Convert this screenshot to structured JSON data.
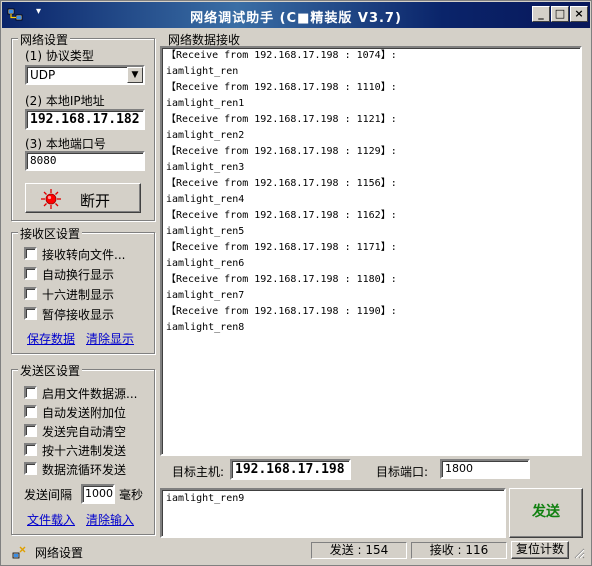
{
  "window": {
    "title": "网络调试助手 (C■精装版 V3.7)",
    "sysmenu_label": "▾",
    "minimize_label": "_",
    "maximize_label": "□",
    "close_label": "×"
  },
  "net_settings": {
    "group_title": "网络设置",
    "protocol_label": "(1) 协议类型",
    "protocol_value": "UDP",
    "ip_label": "(2) 本地IP地址",
    "ip_value": "192.168.17.182",
    "port_label": "(3) 本地端口号",
    "port_value": "8080",
    "connect_button": "断开"
  },
  "recv_settings": {
    "group_title": "接收区设置",
    "options": [
      {
        "label": "接收转向文件...",
        "checked": false
      },
      {
        "label": "自动换行显示",
        "checked": false
      },
      {
        "label": "十六进制显示",
        "checked": false
      },
      {
        "label": "暂停接收显示",
        "checked": false
      }
    ],
    "save_link": "保存数据",
    "clear_link": "清除显示"
  },
  "send_settings": {
    "group_title": "发送区设置",
    "options": [
      {
        "label": "启用文件数据源...",
        "checked": false
      },
      {
        "label": "自动发送附加位",
        "checked": false
      },
      {
        "label": "发送完自动清空",
        "checked": false
      },
      {
        "label": "按十六进制发送",
        "checked": false
      },
      {
        "label": "数据流循环发送",
        "checked": false
      }
    ],
    "interval_label": "发送间隔",
    "interval_value": "1000",
    "interval_unit": "毫秒",
    "load_link": "文件载入",
    "clear_link": "清除输入"
  },
  "receive_area": {
    "group_title": "网络数据接收",
    "lines": [
      {
        "kind": "hdr",
        "text": "【Receive from 192.168.17.198 : 1074】:"
      },
      {
        "kind": "data",
        "text": "iamlight_ren"
      },
      {
        "kind": "hdr",
        "text": "【Receive from 192.168.17.198 : 1110】:"
      },
      {
        "kind": "data",
        "text": "iamlight_ren1"
      },
      {
        "kind": "hdr",
        "text": "【Receive from 192.168.17.198 : 1121】:"
      },
      {
        "kind": "data",
        "text": "iamlight_ren2"
      },
      {
        "kind": "hdr",
        "text": "【Receive from 192.168.17.198 : 1129】:"
      },
      {
        "kind": "data",
        "text": "iamlight_ren3"
      },
      {
        "kind": "hdr",
        "text": "【Receive from 192.168.17.198 : 1156】:"
      },
      {
        "kind": "data",
        "text": "iamlight_ren4"
      },
      {
        "kind": "hdr",
        "text": "【Receive from 192.168.17.198 : 1162】:"
      },
      {
        "kind": "data",
        "text": "iamlight_ren5"
      },
      {
        "kind": "hdr",
        "text": "【Receive from 192.168.17.198 : 1171】:"
      },
      {
        "kind": "data",
        "text": "iamlight_ren6"
      },
      {
        "kind": "hdr",
        "text": "【Receive from 192.168.17.198 : 1180】:"
      },
      {
        "kind": "data",
        "text": "iamlight_ren7"
      },
      {
        "kind": "hdr",
        "text": "【Receive from 192.168.17.198 : 1190】:"
      },
      {
        "kind": "data",
        "text": "iamlight_ren8"
      }
    ]
  },
  "target": {
    "host_label": "目标主机:",
    "host_value": "192.168.17.198",
    "port_label": "目标端口:",
    "port_value": "1800"
  },
  "send_area": {
    "text": "iamlight_ren9",
    "send_button": "发送"
  },
  "statusbar": {
    "status_text": "网络设置",
    "sent": "发送 : 154",
    "received": "接收 : 116",
    "reset_button": "复位计数"
  }
}
